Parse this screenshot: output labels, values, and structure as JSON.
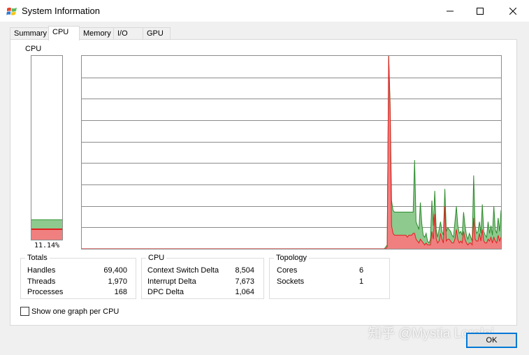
{
  "window": {
    "title": "System Information"
  },
  "tabs": [
    {
      "label": "Summary"
    },
    {
      "label": "CPU"
    },
    {
      "label": "Memory"
    },
    {
      "label": "I/O"
    },
    {
      "label": "GPU"
    }
  ],
  "cpu_meter": {
    "label": "CPU",
    "percent_text": "11.14%",
    "total_fraction": 0.1114,
    "kernel_fraction": 0.06
  },
  "totals": {
    "title": "Totals",
    "rows": [
      {
        "label": "Handles",
        "value": "69,400"
      },
      {
        "label": "Threads",
        "value": "1,970"
      },
      {
        "label": "Processes",
        "value": "168"
      }
    ]
  },
  "cpu_group": {
    "title": "CPU",
    "rows": [
      {
        "label": "Context Switch Delta",
        "value": "8,504"
      },
      {
        "label": "Interrupt Delta",
        "value": "7,673"
      },
      {
        "label": "DPC Delta",
        "value": "1,064"
      }
    ]
  },
  "topology": {
    "title": "Topology",
    "rows": [
      {
        "label": "Cores",
        "value": "6"
      },
      {
        "label": "Sockets",
        "value": "1"
      }
    ]
  },
  "options": {
    "one_graph_per_cpu_label": "Show one graph per CPU",
    "one_graph_per_cpu_checked": false
  },
  "buttons": {
    "ok_label": "OK"
  },
  "watermark": "知乎 @Mystia Lorelei",
  "colors": {
    "total_line": "#2e8b2e",
    "total_fill": "#8ec98e",
    "kernel_line": "#e02020",
    "kernel_fill": "#f08080",
    "grid": "#8c8c8c",
    "focus": "#0078d7"
  },
  "chart_data": {
    "type": "area",
    "ylim": [
      0,
      100
    ],
    "grid_rows": 9,
    "series": [
      {
        "values": [
          0,
          0,
          0,
          0,
          0,
          0,
          0,
          0,
          0,
          0,
          0,
          0,
          0,
          0,
          0,
          0,
          0,
          0,
          0,
          0,
          0,
          0,
          0,
          0,
          0,
          0,
          0,
          0,
          0,
          0,
          0,
          0,
          0,
          0,
          0,
          0,
          0,
          0,
          0,
          0,
          0,
          0,
          0,
          0,
          0,
          0,
          0,
          0,
          0,
          0,
          0,
          0,
          0,
          0,
          0,
          0,
          0,
          0,
          0,
          0,
          0,
          0,
          0,
          0,
          0,
          0,
          0,
          0,
          0,
          0,
          0,
          0,
          0,
          0,
          0,
          0,
          0,
          0,
          0,
          0,
          0,
          0,
          0,
          0,
          0,
          0,
          0,
          0,
          0,
          0,
          0,
          0,
          0,
          0,
          0,
          0,
          0,
          0,
          0,
          0,
          0,
          0,
          0,
          0,
          0,
          0,
          0,
          0,
          0,
          0,
          0,
          0,
          0,
          0,
          0,
          0,
          0,
          0,
          0,
          0,
          0,
          0,
          0,
          0,
          0,
          0,
          0,
          0,
          0,
          0,
          0,
          0,
          0,
          0,
          0,
          0,
          0,
          0,
          0,
          0,
          0,
          0,
          0,
          0,
          0,
          0,
          0,
          0,
          0,
          0,
          0,
          0,
          0,
          0,
          0,
          0,
          0,
          0,
          0,
          0,
          0,
          0,
          0,
          0,
          0,
          0,
          0,
          0,
          0,
          0,
          0,
          0,
          0,
          0,
          0,
          0,
          0,
          0,
          0,
          0,
          0,
          0,
          0,
          0,
          0,
          0,
          0,
          0,
          0,
          0,
          0,
          0,
          0,
          0,
          0,
          0,
          0,
          0,
          0,
          0,
          0,
          0,
          0,
          0,
          0,
          0,
          0,
          0,
          0,
          0,
          0,
          1,
          2,
          100,
          76,
          25,
          20,
          19,
          19,
          19,
          19,
          19,
          19,
          19,
          19,
          19,
          19,
          19,
          19,
          19,
          19,
          46,
          14,
          12,
          10,
          24,
          13,
          7,
          6,
          8,
          4,
          3,
          5,
          25,
          12,
          30,
          10,
          6,
          10,
          14,
          9,
          7,
          31,
          9,
          11,
          10,
          9,
          7,
          6,
          14,
          22,
          12,
          8,
          9,
          7,
          19,
          12,
          7,
          5,
          8,
          6,
          4,
          38,
          12,
          8,
          9,
          14,
          8,
          23,
          9,
          7,
          6,
          14,
          8,
          12,
          7,
          22,
          10,
          8,
          16,
          9,
          20
        ]
      },
      {
        "values": [
          0,
          0,
          0,
          0,
          0,
          0,
          0,
          0,
          0,
          0,
          0,
          0,
          0,
          0,
          0,
          0,
          0,
          0,
          0,
          0,
          0,
          0,
          0,
          0,
          0,
          0,
          0,
          0,
          0,
          0,
          0,
          0,
          0,
          0,
          0,
          0,
          0,
          0,
          0,
          0,
          0,
          0,
          0,
          0,
          0,
          0,
          0,
          0,
          0,
          0,
          0,
          0,
          0,
          0,
          0,
          0,
          0,
          0,
          0,
          0,
          0,
          0,
          0,
          0,
          0,
          0,
          0,
          0,
          0,
          0,
          0,
          0,
          0,
          0,
          0,
          0,
          0,
          0,
          0,
          0,
          0,
          0,
          0,
          0,
          0,
          0,
          0,
          0,
          0,
          0,
          0,
          0,
          0,
          0,
          0,
          0,
          0,
          0,
          0,
          0,
          0,
          0,
          0,
          0,
          0,
          0,
          0,
          0,
          0,
          0,
          0,
          0,
          0,
          0,
          0,
          0,
          0,
          0,
          0,
          0,
          0,
          0,
          0,
          0,
          0,
          0,
          0,
          0,
          0,
          0,
          0,
          0,
          0,
          0,
          0,
          0,
          0,
          0,
          0,
          0,
          0,
          0,
          0,
          0,
          0,
          0,
          0,
          0,
          0,
          0,
          0,
          0,
          0,
          0,
          0,
          0,
          0,
          0,
          0,
          0,
          0,
          0,
          0,
          0,
          0,
          0,
          0,
          0,
          0,
          0,
          0,
          0,
          0,
          0,
          0,
          0,
          0,
          0,
          0,
          0,
          0,
          0,
          0,
          0,
          0,
          0,
          0,
          0,
          0,
          0,
          0,
          0,
          0,
          0,
          0,
          0,
          0,
          0,
          0,
          0,
          0,
          0,
          0,
          0,
          0,
          0,
          0,
          0,
          0,
          0,
          0,
          0,
          1,
          100,
          72,
          12,
          8,
          7,
          7,
          7,
          7,
          7,
          7,
          7,
          7,
          7,
          6,
          7,
          7,
          7,
          8,
          8,
          5,
          4,
          3,
          5,
          4,
          3,
          2,
          3,
          2,
          2,
          2,
          9,
          5,
          18,
          5,
          3,
          4,
          8,
          5,
          3,
          22,
          4,
          5,
          5,
          4,
          3,
          3,
          5,
          10,
          5,
          3,
          4,
          3,
          9,
          5,
          3,
          2,
          3,
          3,
          2,
          16,
          5,
          4,
          4,
          8,
          4,
          10,
          4,
          3,
          3,
          5,
          4,
          6,
          3,
          6,
          4,
          3,
          7,
          4,
          6
        ]
      }
    ]
  }
}
